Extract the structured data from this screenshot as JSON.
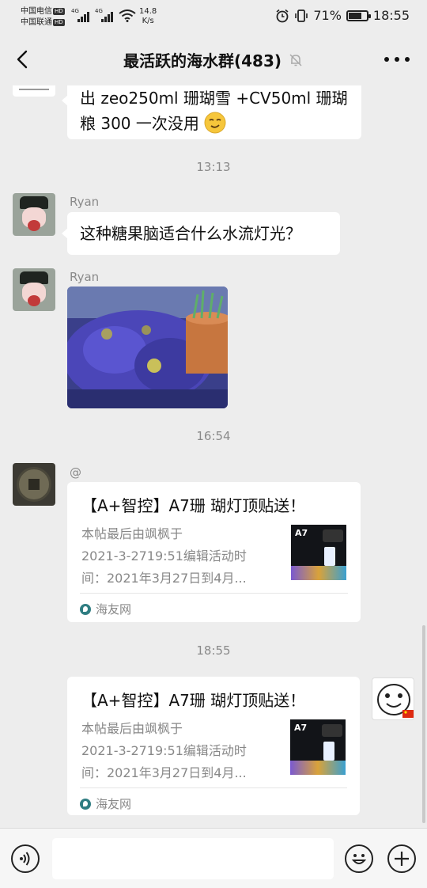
{
  "status_bar": {
    "carrier_1": "中国电信",
    "carrier_2": "中国联通",
    "hd_tag": "HD",
    "net_type": "4G",
    "net_speed": "14.8",
    "net_speed_unit": "K/s",
    "battery": "71%",
    "battery_level": 0.71,
    "time": "18:55"
  },
  "header": {
    "title": "最活跃的海水群(483)"
  },
  "messages": {
    "m0": {
      "text_line1": "出 zeo250ml 珊瑚雪 +CV50ml 珊瑚",
      "text_line2": "粮  300  一次没用 "
    },
    "ts1": "13:13",
    "m1": {
      "sender": "Ryan",
      "text": "这种糖果脑适合什么水流灯光？"
    },
    "m2": {
      "sender": "Ryan"
    },
    "ts2": "16:54",
    "m3": {
      "sender": "@",
      "title": "【A+智控】A7珊 瑚灯顶贴送！",
      "desc_lines": [
        "本帖最后由飒枫于",
        "2021-3-2719:51编辑活动时",
        "间：2021年3月27日到4月..."
      ],
      "source": "海友网",
      "thumb_label": "A7"
    },
    "ts3": "18:55",
    "m4": {
      "title": "【A+智控】A7珊 瑚灯顶贴送！",
      "desc_lines": [
        "本帖最后由飒枫于",
        "2021-3-2719:51编辑活动时",
        "间：2021年3月27日到4月..."
      ],
      "source": "海友网",
      "thumb_label": "A7"
    }
  },
  "input": {
    "placeholder": ""
  },
  "icons": {
    "back": "back-arrow-icon",
    "mute": "bell-off-icon",
    "more": "more-dots-icon",
    "voice": "voice-icon",
    "emoji": "emoji-icon",
    "plus": "plus-icon",
    "alarm": "alarm-icon",
    "vibrate": "vibrate-icon",
    "wifi": "wifi-icon"
  }
}
